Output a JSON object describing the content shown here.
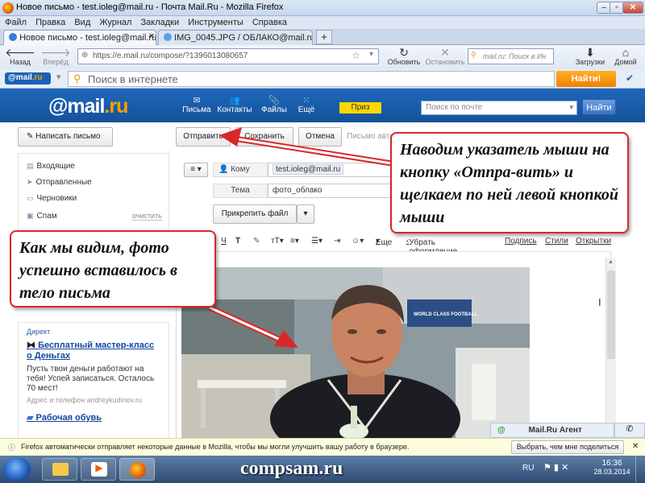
{
  "window": {
    "title": "Новое письмо - test.ioleg@mail.ru - Почта Mail.Ru - Mozilla Firefox"
  },
  "menu": [
    "Файл",
    "Правка",
    "Вид",
    "Журнал",
    "Закладки",
    "Инструменты",
    "Справка"
  ],
  "tabs": [
    {
      "label": "Новое письмо - test.ioleg@mail.ru - ..."
    },
    {
      "label": "IMG_0045.JPG / ОБЛАКО@mail.ru"
    }
  ],
  "nav": {
    "back": "Назад",
    "forward": "Вперёд",
    "url": "https://e.mail.ru/compose/?1396013080657",
    "refresh": "Обновить",
    "stop": "Остановить",
    "search_placeholder": "mail.ru: Поиск в Ин",
    "downloads": "Загрузки",
    "home": "Домой"
  },
  "toolbar": {
    "badge_mail": "@mail",
    "badge_ru": ".ru",
    "search_placeholder": "Поиск в интернете",
    "find": "Найти!"
  },
  "mail_header": {
    "logo_at": "@mail",
    "logo_ru": ".ru",
    "nav": [
      "Письма",
      "Контакты",
      "Файлы",
      "Ещё"
    ],
    "priz": "Приз",
    "search_placeholder": "Поиск по почте",
    "find": "Найти"
  },
  "sidebar": {
    "compose": "Написать письмо",
    "folders": [
      "Входящие",
      "Отправленные",
      "Черновики",
      "Спам"
    ],
    "clear": "очистить"
  },
  "compose": {
    "send": "Отправить",
    "save": "Сохранить",
    "cancel": "Отмена",
    "draft_status": "Письмо авто",
    "to_label": "Кому",
    "to_value": "test.ioleg@mail.ru",
    "subject_label": "Тема",
    "subject_value": "фото_облако",
    "attach": "Прикрепить файл"
  },
  "format_bar": {
    "more": "Еще",
    "remove_format": "Убрать оформление",
    "signature": "Подпись",
    "styles": "Стили",
    "postcards": "Открытки"
  },
  "ad": {
    "direct": "Директ",
    "title1": "Бесплатный мастер-класс о Деньгах",
    "text1": "Пусть твои деньги работают на тебя! Успей записаться. Осталось 70 мест!",
    "contact1": "Адрес и телефон  andreykudinov.ru",
    "title2": "Рабочая обувь"
  },
  "callouts": {
    "send_hint": "Наводим указатель мыши на кнопку «Отпра-вить» и щелкаем по ней левой кнопкой мыши",
    "photo_hint": "Как мы видим, фото успешно вставилось в тело письма"
  },
  "photo": {
    "banner": "WORLD CLASS FOOTBALL"
  },
  "agent": {
    "label": "Mail.Ru Агент"
  },
  "notification": {
    "text": "Firefox автоматически отправляет некоторые данные в Mozilla, чтобы мы могли улучшить вашу работу в браузере.",
    "button": "Выбрать, чем мне поделиться"
  },
  "taskbar": {
    "brand": "compsam.ru",
    "lang": "RU",
    "time": "16:36",
    "date": "28.03.2014"
  },
  "colors": {
    "mail_blue": "#1f68bb",
    "mail_orange": "#ff9e00",
    "callout_red": "#d9282a"
  }
}
